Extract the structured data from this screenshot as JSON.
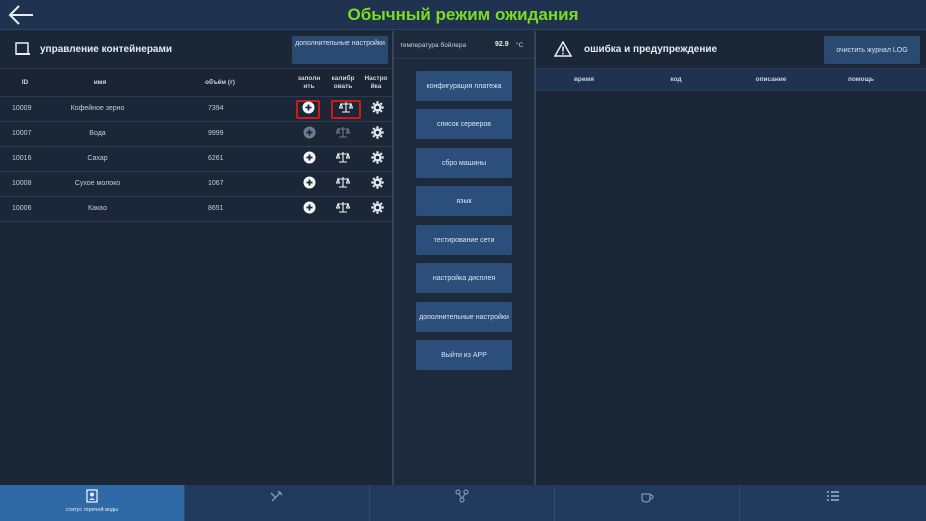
{
  "header": {
    "title": "Обычный режим ожидания"
  },
  "containers": {
    "title": "управление контейнерами",
    "extra_settings_label": "дополнительные настройки",
    "columns": {
      "id": "ID",
      "name": "имя",
      "volume": "объём (г)",
      "fill": "заполн ить",
      "calibrate": "калибр овать",
      "settings": "Настро йка"
    },
    "rows": [
      {
        "id": "10009",
        "name": "Кофейное зерно",
        "volume": "7394"
      },
      {
        "id": "10007",
        "name": "Вода",
        "volume": "9999"
      },
      {
        "id": "10016",
        "name": "Сахар",
        "volume": "6261"
      },
      {
        "id": "10008",
        "name": "Сухое молоко",
        "volume": "1067"
      },
      {
        "id": "10006",
        "name": "Какао",
        "volume": "8651"
      }
    ]
  },
  "middle": {
    "temp_label": "температура бойлера",
    "temp_value": "92.9",
    "temp_unit": "°C",
    "buttons": [
      "конфигурация платежа",
      "список серверов",
      "сбро машины",
      "язык",
      "тестирование сети",
      "настройка дисплея",
      "дополнительные настройки",
      "Выйти из APP"
    ]
  },
  "errors": {
    "title": "ошибка и предупреждение",
    "clear_label": "очистить журнал LOG",
    "columns": {
      "time": "время",
      "code": "код",
      "description": "описание",
      "help": "помощь"
    }
  },
  "tabs": [
    {
      "label": "статус горячей воды",
      "icon": "user-card-icon"
    },
    {
      "label": "",
      "icon": "tools-icon"
    },
    {
      "label": "",
      "icon": "network-icon"
    },
    {
      "label": "",
      "icon": "cup-icon"
    },
    {
      "label": "",
      "icon": "list-icon"
    }
  ],
  "colors": {
    "title": "#7ddc1f",
    "highlight": "#d01919",
    "active_tab": "#2f6aa6"
  }
}
